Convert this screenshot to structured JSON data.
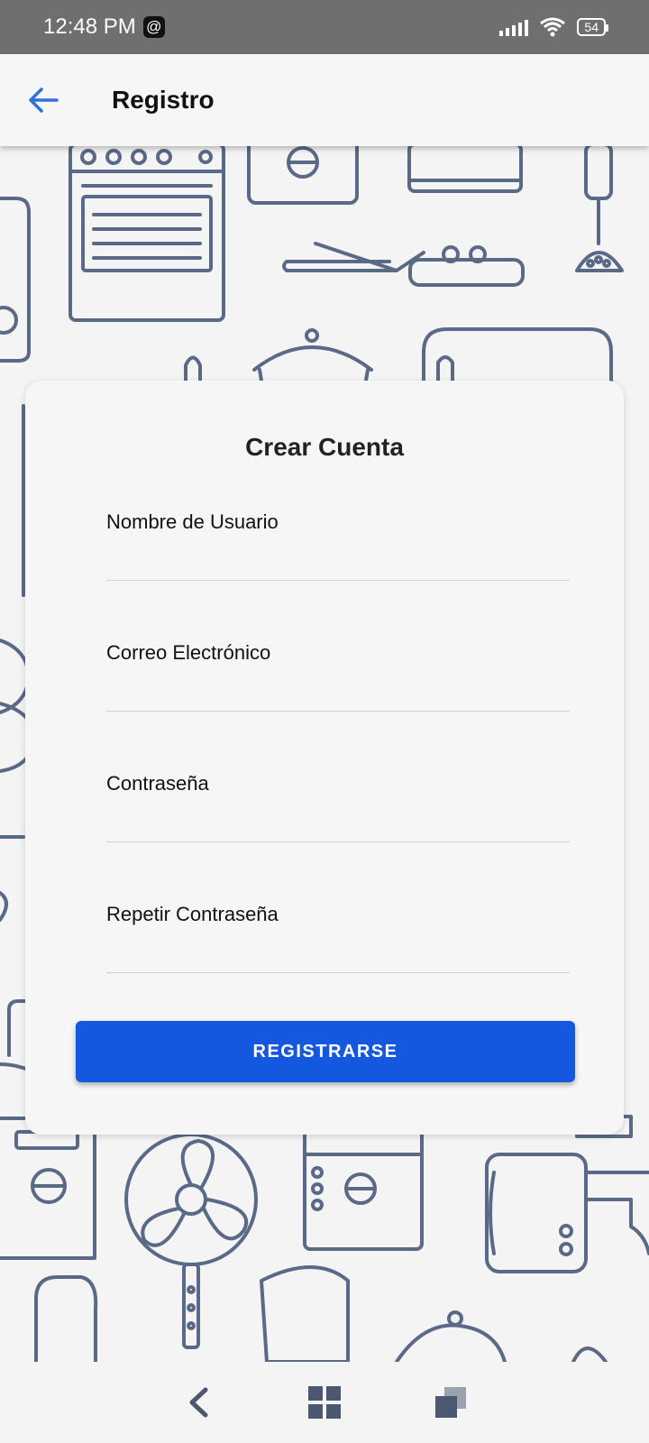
{
  "status_bar": {
    "time": "12:48 PM",
    "threads_glyph": "@",
    "battery": "54",
    "icons": [
      "threads-icon",
      "signal-icon",
      "wifi-icon",
      "battery-icon"
    ]
  },
  "app_bar": {
    "title": "Registro",
    "back_icon": "arrow-left-icon",
    "accent_color": "#2f6fe0"
  },
  "form": {
    "title": "Crear Cuenta",
    "fields": [
      {
        "label": "Nombre de Usuario",
        "value": ""
      },
      {
        "label": "Correo Electrónico",
        "value": ""
      },
      {
        "label": "Contraseña",
        "value": ""
      },
      {
        "label": "Repetir Contraseña",
        "value": ""
      }
    ],
    "submit_label": "REGISTRARSE",
    "submit_color": "#1558e0"
  },
  "nav_bar": {
    "icons": [
      "back-nav-icon",
      "home-nav-icon",
      "recents-nav-icon"
    ]
  }
}
